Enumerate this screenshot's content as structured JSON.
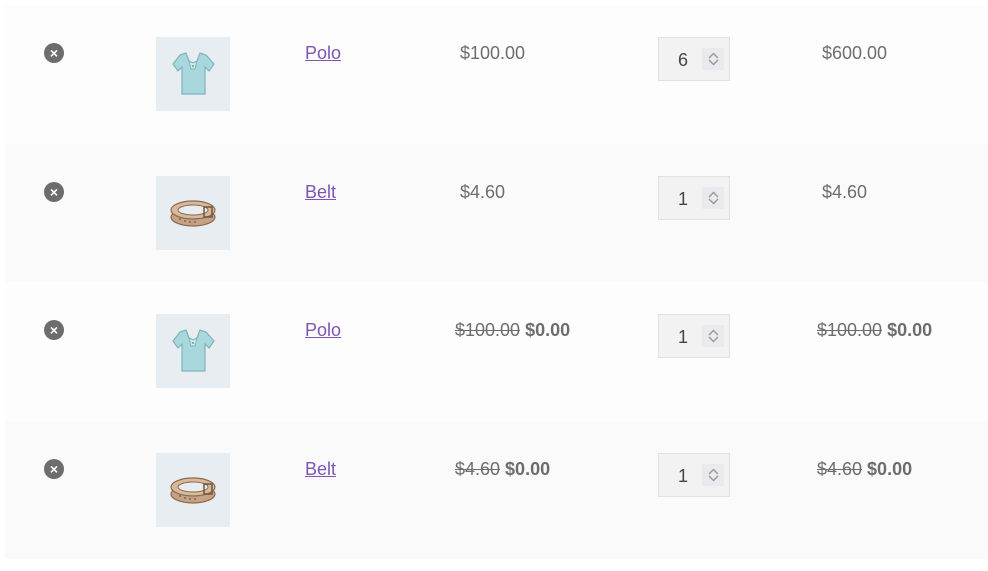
{
  "cart": {
    "items": [
      {
        "name": "Polo",
        "image_icon": "polo-shirt-icon",
        "price": "$100.00",
        "price_old": "",
        "quantity": "6",
        "subtotal": "$600.00",
        "subtotal_old": ""
      },
      {
        "name": "Belt",
        "image_icon": "belt-icon",
        "price": "$4.60",
        "price_old": "",
        "quantity": "1",
        "subtotal": "$4.60",
        "subtotal_old": ""
      },
      {
        "name": "Polo",
        "image_icon": "polo-shirt-icon",
        "price": "$0.00",
        "price_old": "$100.00",
        "quantity": "1",
        "subtotal": "$0.00",
        "subtotal_old": "$100.00"
      },
      {
        "name": "Belt",
        "image_icon": "belt-icon",
        "price": "$0.00",
        "price_old": "$4.60",
        "quantity": "1",
        "subtotal": "$0.00",
        "subtotal_old": "$4.60"
      }
    ],
    "remove_icon": "remove-x-icon",
    "colors": {
      "link": "#7f54b3",
      "text": "#6d6d6d",
      "thumb_bg": "#e8edf2",
      "remove_bg": "#6d6d6d"
    }
  }
}
